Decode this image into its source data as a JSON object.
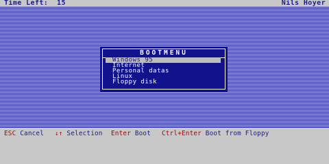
{
  "topbar": {
    "timer_label": "Time Left:  15",
    "user_name": "Nils Hoyer"
  },
  "menu": {
    "title": "BOOTMENU",
    "selected_index": 0,
    "items": [
      {
        "label": "Windows 95"
      },
      {
        "label": "Internet"
      },
      {
        "label": "Personal datas"
      },
      {
        "label": "Linux"
      },
      {
        "label": "Floppy disk"
      }
    ]
  },
  "footer": {
    "esc_key": "ESC",
    "esc_action": "Cancel",
    "arrows_key": "↓↑",
    "arrows_action": "Selection",
    "enter_key": "Enter",
    "enter_action": "Boot",
    "ctrl_key": "Ctrl+Enter",
    "ctrl_action": "Boot from Floppy"
  },
  "colors": {
    "menu_bg": "#12128c",
    "selection_bg": "#bcbcbc",
    "key_red": "#b00000",
    "text_blue": "#1a1a8c"
  }
}
